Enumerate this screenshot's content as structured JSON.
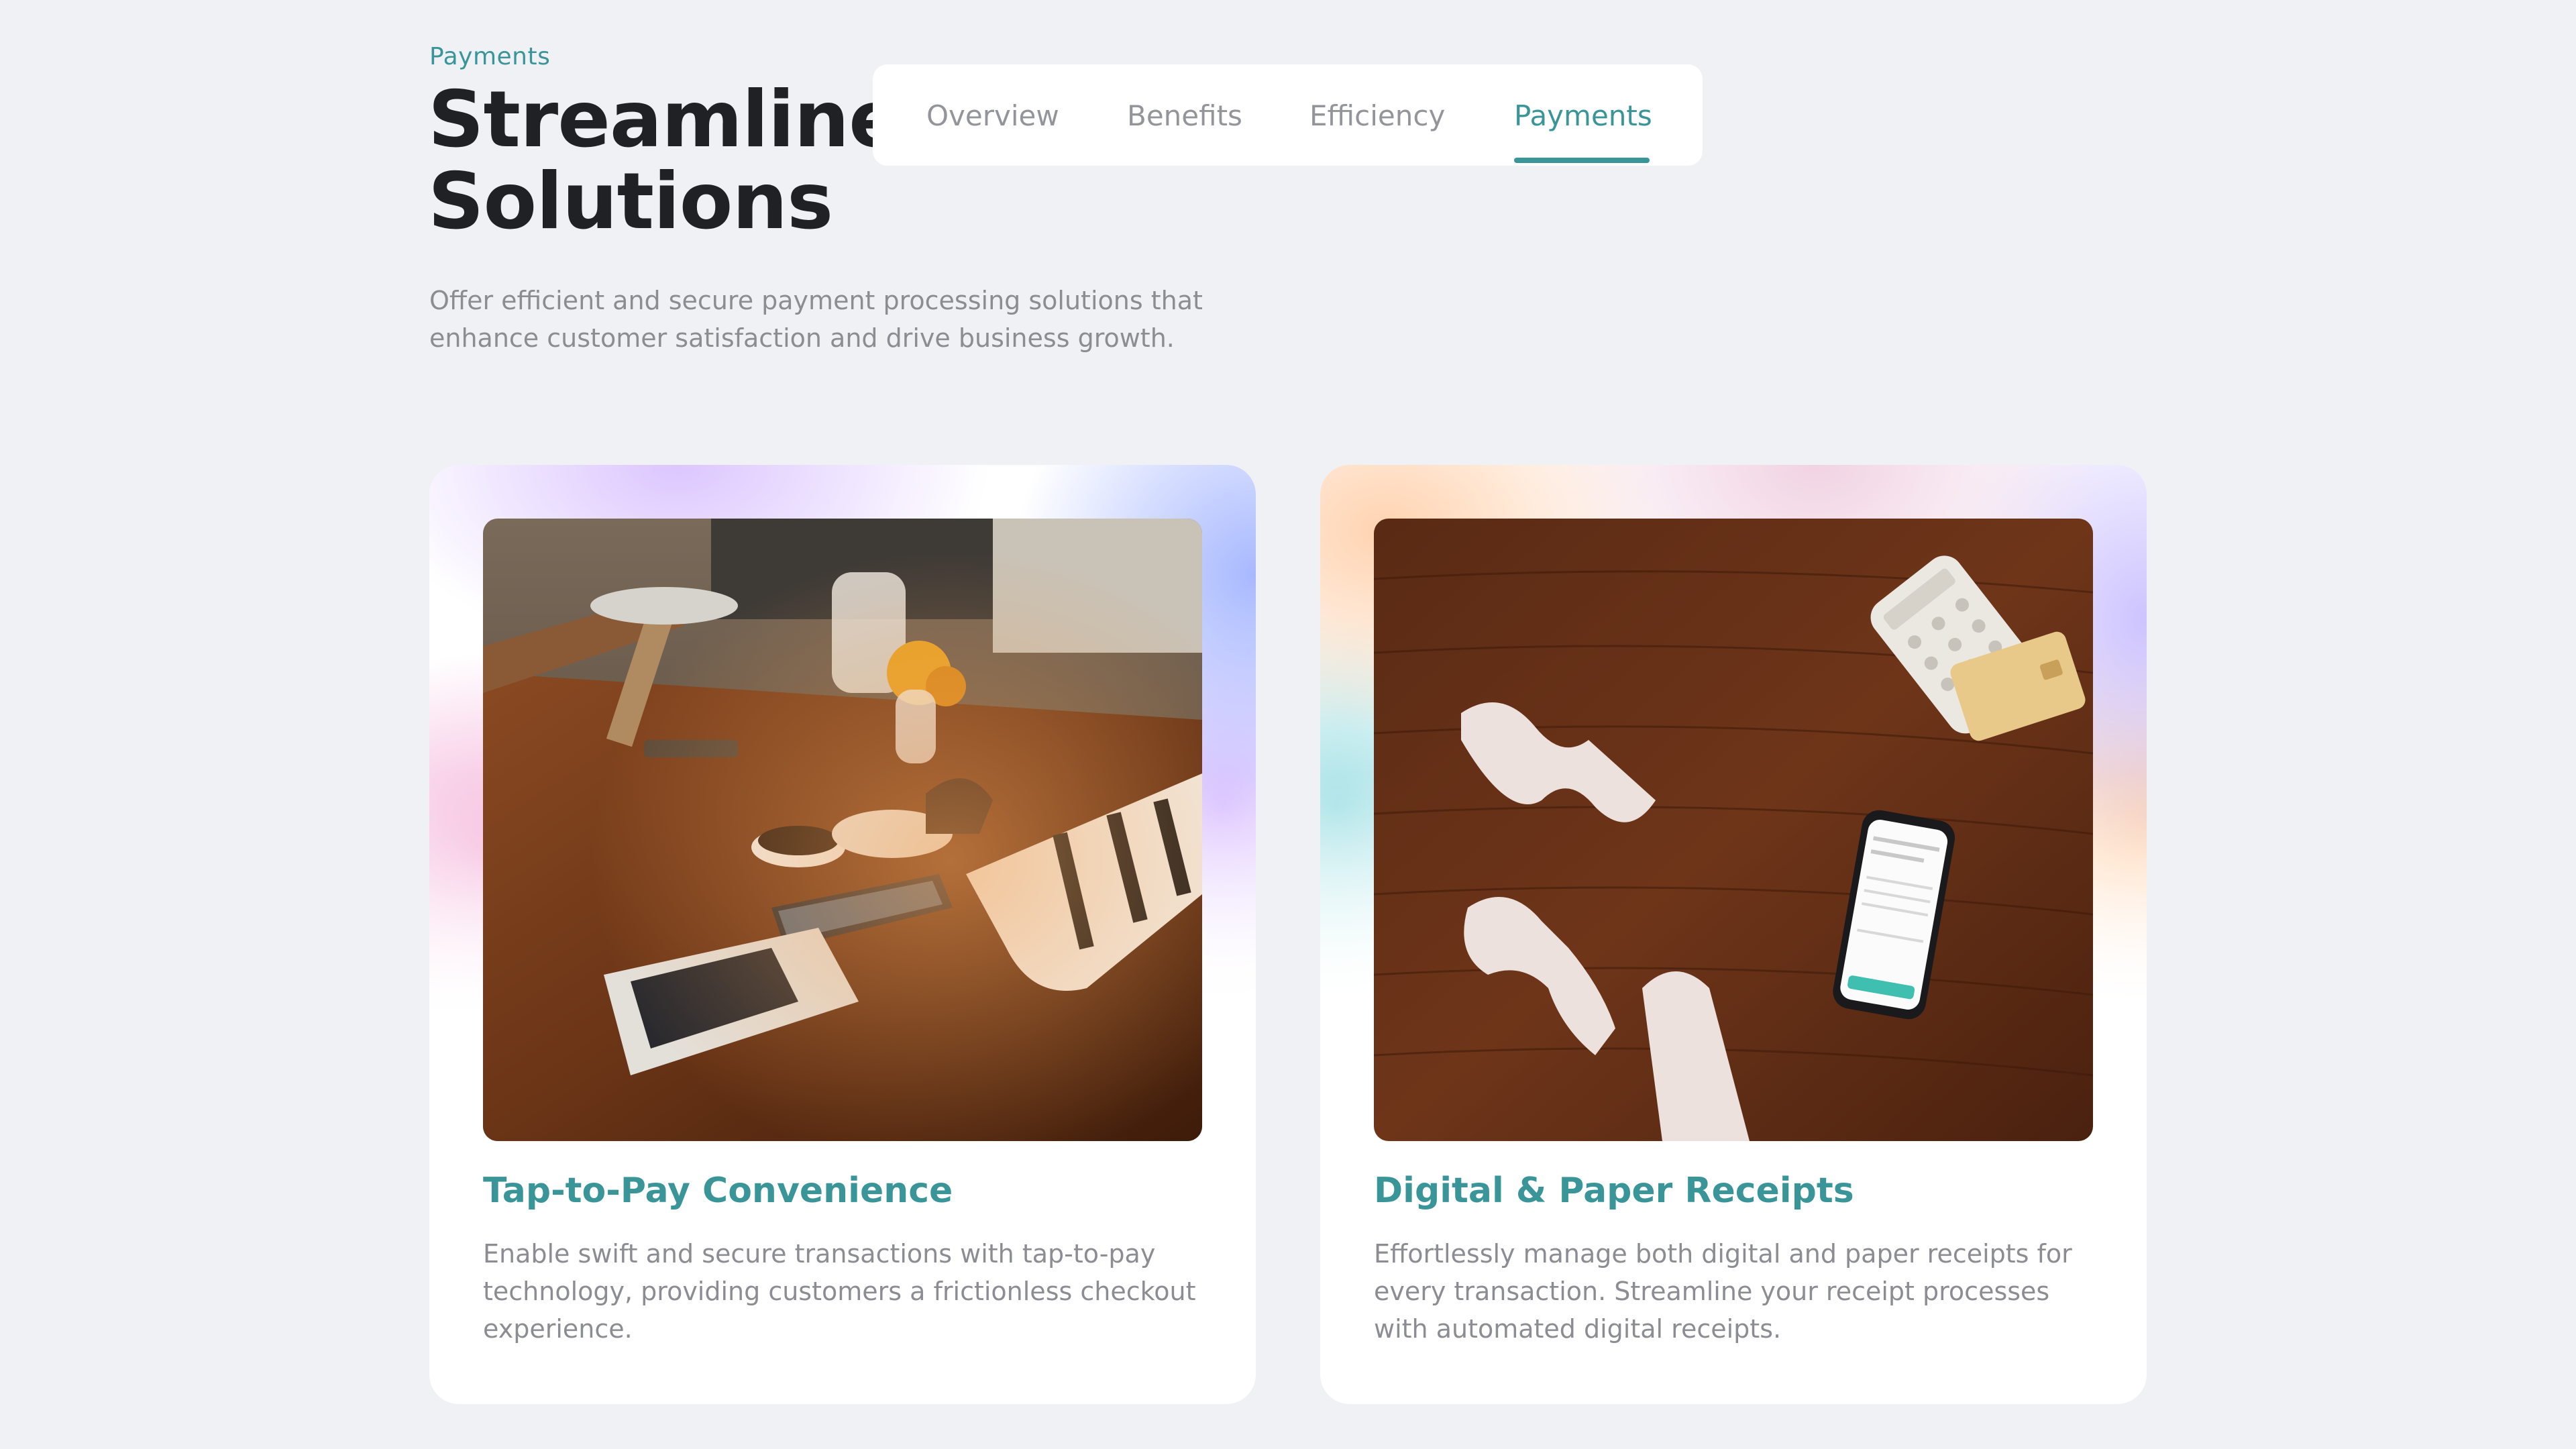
{
  "header": {
    "eyebrow": "Payments",
    "title_line1": "Streamlined Payment",
    "title_line2": "Solutions",
    "subtitle": "Offer efficient and secure payment processing solutions that enhance customer satisfaction and drive business growth."
  },
  "tabs": {
    "items": [
      {
        "label": "Overview"
      },
      {
        "label": "Benefits"
      },
      {
        "label": "Efficiency"
      },
      {
        "label": "Payments"
      }
    ],
    "active": "Payments"
  },
  "cards": [
    {
      "title": "Tap-to-Pay Convenience",
      "text": "Enable swift and secure transactions with tap-to-pay technology, providing customers a frictionless checkout experience."
    },
    {
      "title": "Digital & Paper Receipts",
      "text": "Effortlessly manage both digital and paper receipts for every transaction. Streamline your receipt processes with automated digital receipts."
    }
  ],
  "colors": {
    "accent": "#3a9598",
    "background": "#f0f1f5",
    "heading": "#1f2124",
    "muted_text": "#8c8d93"
  }
}
